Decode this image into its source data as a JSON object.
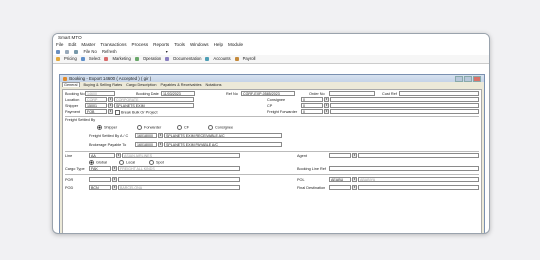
{
  "app": {
    "title": "Smart MTO"
  },
  "menu": [
    "File",
    "Edit",
    "Master",
    "Transactions",
    "Process",
    "Reports",
    "Tools",
    "Windows",
    "Help",
    "Module"
  ],
  "toolbar1": {
    "file_no_label": "File No",
    "refresh_label": "Refresh"
  },
  "toolbar2": [
    "Pricing",
    "Select",
    "Marketing",
    "Operation",
    "Documentation",
    "Accounts",
    "Payroll"
  ],
  "child": {
    "title": "Booking - Export 14600 ( Accepted ) ( gir )"
  },
  "tabs": [
    "General",
    "Buying & Selling Rates",
    "Cargo Description",
    "Payables & Receivables",
    "Notations"
  ],
  "form": {
    "booking_no_label": "Booking No",
    "booking_no": "14600",
    "booking_date_label": "Booking Date",
    "booking_date": "11/03/2023",
    "ref_no_label": "Ref No",
    "ref_no": "CGRF-EXP-0585/2023",
    "order_no_label": "Order No",
    "cust_ref_label": "Cust Ref",
    "location_label": "Location",
    "location_code": "CORP",
    "location_name": "CORPORATE",
    "consignee_label": "Consignee",
    "consignee_code": "0",
    "shipper_label": "Shipper",
    "shipper_code": "15001",
    "shipper_name": "SPLANETS EXIM",
    "cp_label": "CP",
    "cp_code": "0",
    "payment_label": "Payment",
    "payment_value": "FOB",
    "break_bulk_label": "Break Bulk Or Project",
    "freight_forwarder_label": "Freight Forwarder",
    "freight_forwarder_code": "0",
    "freight_settled_label": "Freight Settled By",
    "fs_options": [
      "Shipper",
      "Forwarder",
      "CF",
      "Consignee"
    ],
    "fs_selected": "Shipper",
    "fs_by_label": "Freight Settled By A / C",
    "fs_by_code": "16018000",
    "fs_by_name": "SPLANETS EXIM RECEIVABLE A/C",
    "brokerage_label": "Brokerage Payable To",
    "brokerage_code": "16018000",
    "brokerage_name": "SPLANETS EXIM PAYABLE A/C",
    "line_label": "Line",
    "line_code": "AA",
    "line_name": "ASIAN AIRLINES",
    "agent_label": "Agent",
    "scope_options": [
      "Global",
      "Local",
      "Spot"
    ],
    "scope_selected": "Global",
    "cargo_type_label": "Cargo Type",
    "cargo_type_code": "FAK",
    "cargo_type_name": "FREIGHT ALL KINDS",
    "booking_line_ref_label": "Booking Line Ref",
    "por_label": "POR",
    "pol_label": "POL",
    "pol_code": "AEABU",
    "pol_name": "ABABIYA",
    "pod_label": "POD",
    "pod_code": "BCN",
    "pod_name": "BARCELONA",
    "final_destination_label": "Final Destination"
  },
  "colors": {
    "title_bar": "#c4d3e7",
    "window_bg": "#ece9d8"
  }
}
